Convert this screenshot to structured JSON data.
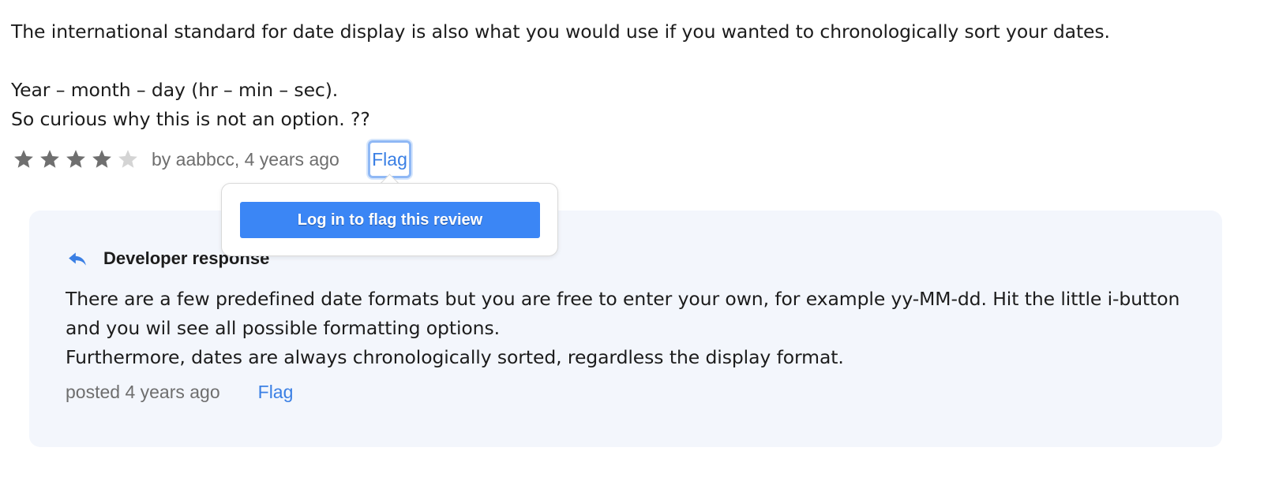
{
  "review": {
    "lines": [
      "The international standard for date display is also what you would use if you wanted to chronologically sort your dates.",
      "Year – month – day (hr – min – sec).",
      "So curious why this is not an option. ??"
    ],
    "rating": {
      "value": 4,
      "max": 5
    },
    "byline": "by aabbcc, 4 years ago",
    "flag_label": "Flag"
  },
  "popover": {
    "button_label": "Log in to flag this review"
  },
  "developer_response": {
    "title": "Developer response",
    "icon": "reply-icon",
    "paragraphs": [
      "There are a few predefined date formats but you are free to enter your own, for example yy-MM-dd. Hit the little i-button and you wil see all possible formatting options.",
      "Furthermore, dates are always chronologically sorted, regardless the display format."
    ],
    "posted": "posted 4 years ago",
    "flag_label": "Flag"
  },
  "colors": {
    "link": "#3a7fe4",
    "button": "#3b86f5",
    "star_filled": "#6f6f6f",
    "star_empty": "#d4d4d4",
    "card_background": "#f3f6fc"
  }
}
